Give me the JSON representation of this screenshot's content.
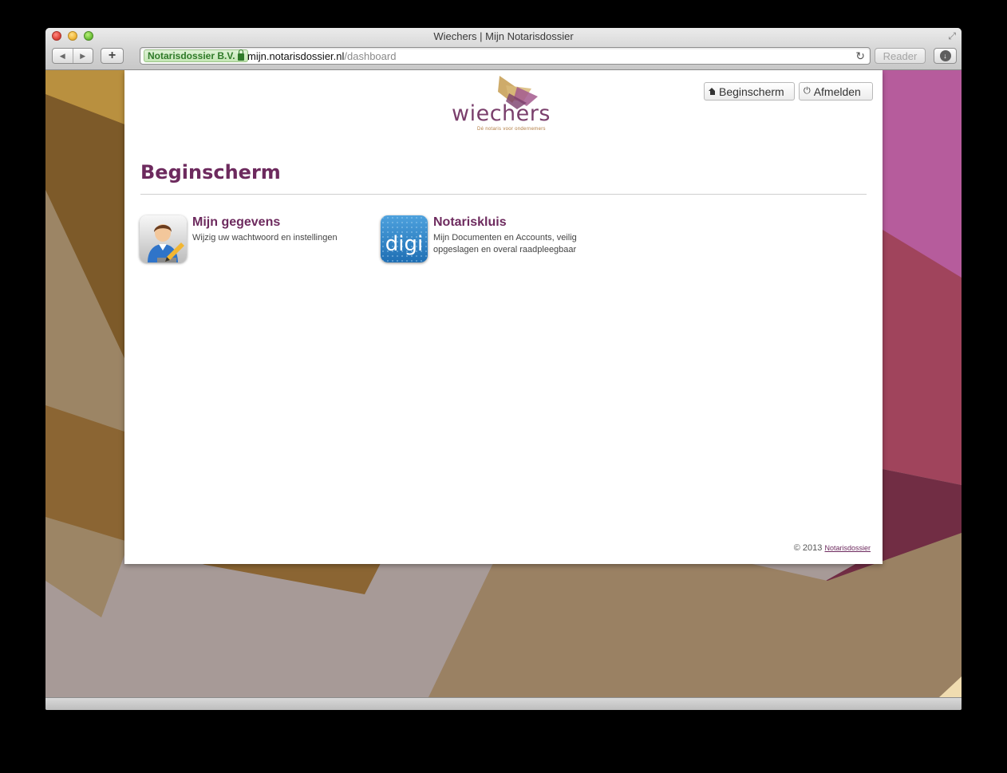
{
  "window": {
    "title": "Wiechers | Mijn Notarisdossier"
  },
  "toolbar": {
    "ev_cert": "Notarisdossier B.V.",
    "url_host": "mijn.notarisdossier.nl",
    "url_path": "/dashboard",
    "reader_label": "Reader"
  },
  "header": {
    "logo_text": "wiechers",
    "logo_tagline": "Dé notaris voor ondernemers",
    "home_button": "Beginscherm",
    "logout_button": "Afmelden"
  },
  "main": {
    "heading": "Beginscherm",
    "tiles": [
      {
        "title": "Mijn gegevens",
        "description": "Wijzig uw wachtwoord en instellingen",
        "icon": "user-edit-icon"
      },
      {
        "title": "Notariskluis",
        "description": "Mijn Documenten en Accounts, veilig opgeslagen en overal raadpleegbaar",
        "icon": "digi-icon",
        "icon_text": "digi"
      }
    ]
  },
  "footer": {
    "copyright": "© 2013",
    "link": "Notarisdossier"
  },
  "colors": {
    "brand_purple": "#6d2a5e",
    "ev_green": "#2f7a29",
    "bg_gold": "#b38a3e",
    "bg_magenta": "#b65c9c"
  }
}
